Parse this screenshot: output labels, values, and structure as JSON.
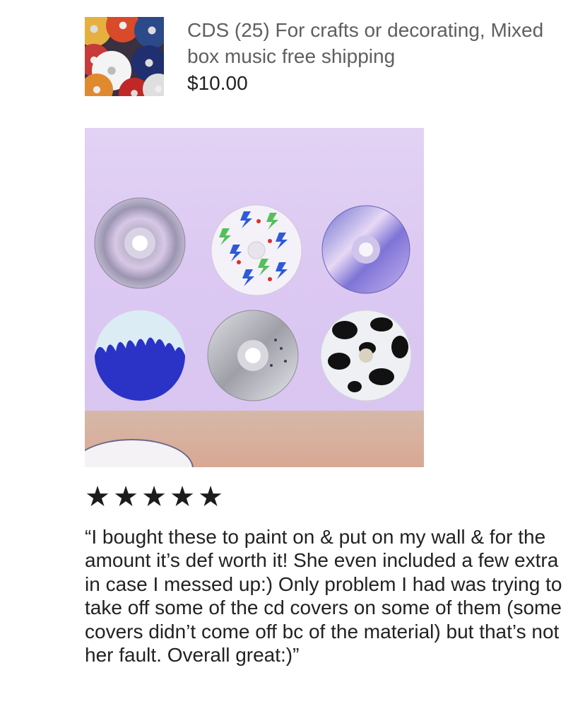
{
  "listing": {
    "title": "CDS (25) For crafts or decorating, Mixed box music free shipping",
    "price": "$10.00"
  },
  "review": {
    "rating": 5,
    "rating_max": 5,
    "star_glyph": "★",
    "text": "“I bought these to paint on & put on my wall & for the amount it’s def worth it! She even included a few extra in case I messed up:) Only problem I had was trying to take off some of the cd covers on some of them (some covers didn’t come off bc of the material) but that’s not her fault. Overall great:)”"
  },
  "colors": {
    "title": "#5f5f5f",
    "text": "#222222",
    "star": "#1c1c1c",
    "photo_background": "#dcc9f2"
  }
}
